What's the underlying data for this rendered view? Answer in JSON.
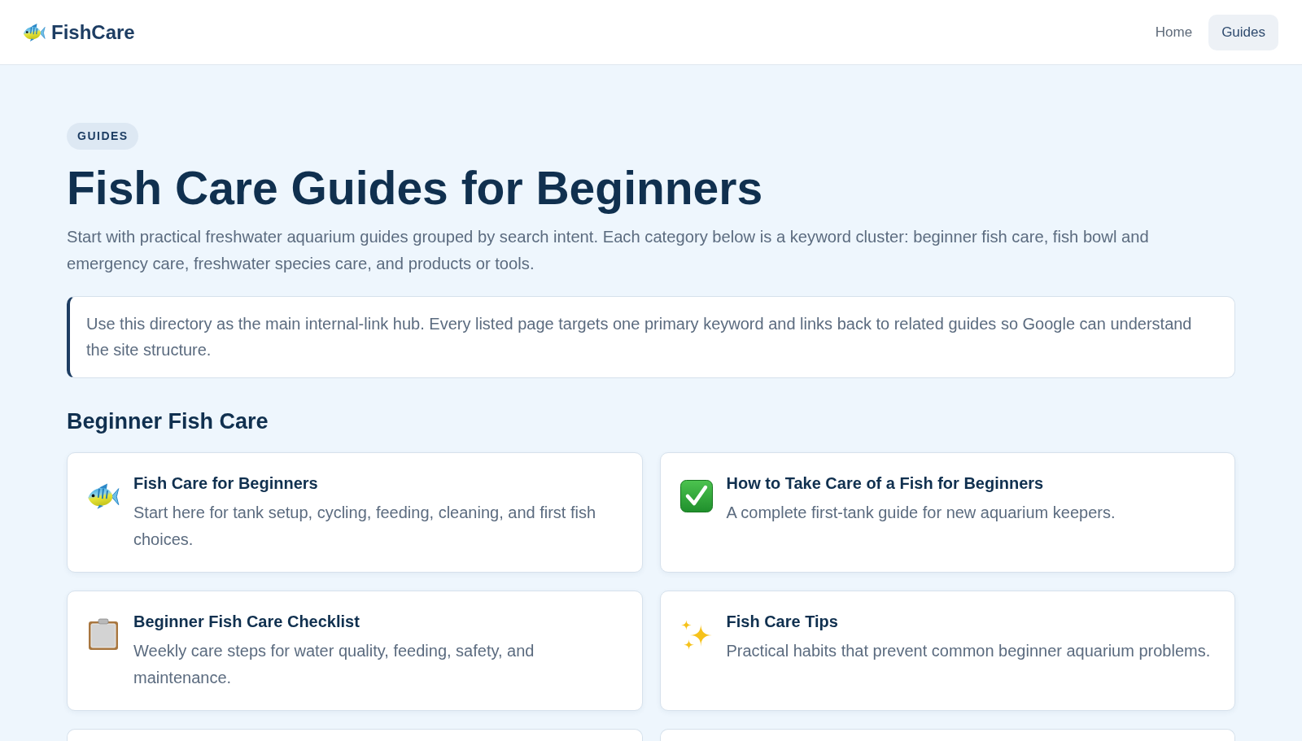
{
  "navbar": {
    "brand": "FishCare",
    "links": [
      {
        "label": "Home",
        "selected": false
      },
      {
        "label": "Guides",
        "selected": true
      }
    ]
  },
  "header": {
    "badge": "GUIDES",
    "title": "Fish Care Guides for Beginners",
    "intro": "Start with practical freshwater aquarium guides grouped by search intent. Each category below is a keyword cluster: beginner fish care, fish bowl and emergency care, freshwater species care, and products or tools."
  },
  "callout": {
    "text": "Use this directory as the main internal-link hub. Every listed page targets one primary keyword and links back to related guides so Google can understand the site structure."
  },
  "sections": [
    {
      "heading": "Beginner Fish Care",
      "cards": [
        {
          "kind": "guide",
          "title": "Fish Care for Beginners",
          "description": "Start here for tank setup, cycling, feeding, cleaning, and first fish choices."
        },
        {
          "kind": "guide",
          "title": "How to Take Care of a Fish for Beginners",
          "description": "A complete first-tank guide for new aquarium keepers."
        },
        {
          "kind": "guide",
          "title": "Beginner Fish Care Checklist",
          "description": "Weekly care steps for water quality, feeding, safety, and maintenance."
        },
        {
          "kind": "guide",
          "title": "Fish Care Tips",
          "description": "Practical habits that prevent common beginner aquarium problems."
        },
        {
          "kind": "clipped"
        },
        {
          "kind": "clipped"
        }
      ]
    }
  ]
}
